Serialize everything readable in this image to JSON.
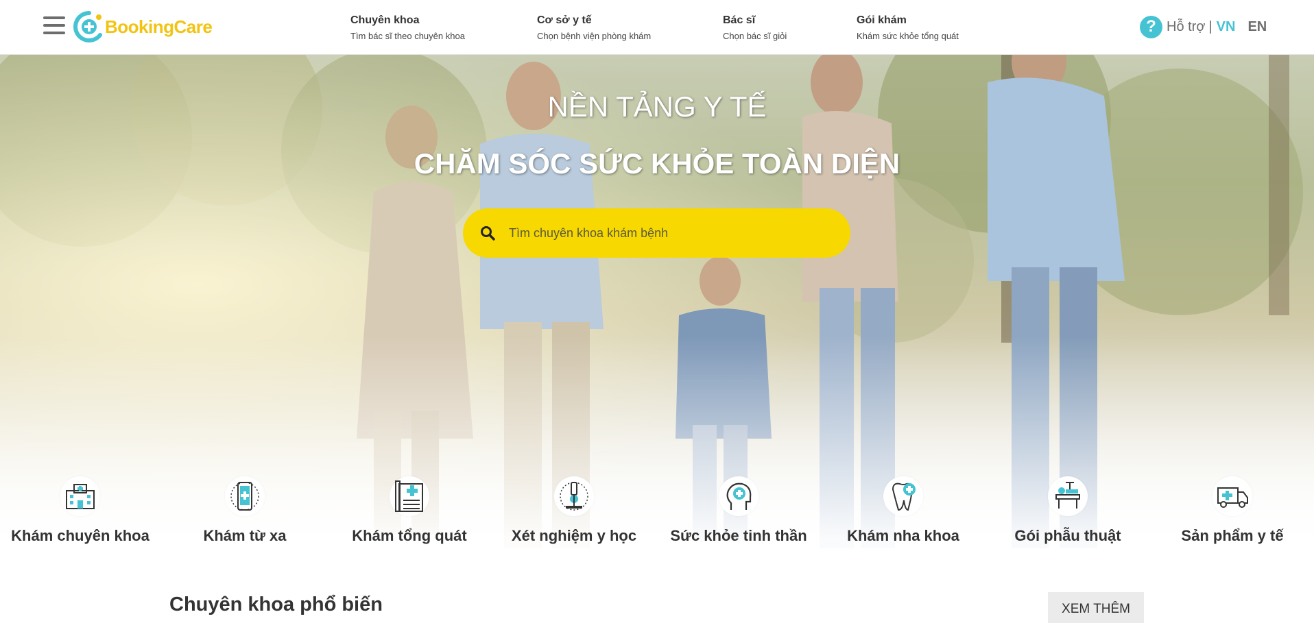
{
  "header": {
    "logo_text": "BookingCare",
    "nav": [
      {
        "title": "Chuyên khoa",
        "subtitle": "Tìm bác sĩ theo chuyên khoa"
      },
      {
        "title": "Cơ sở y tế",
        "subtitle": "Chọn bệnh viện phòng khám"
      },
      {
        "title": "Bác sĩ",
        "subtitle": "Chọn bác sĩ giỏi"
      },
      {
        "title": "Gói khám",
        "subtitle": "Khám sức khỏe tổng quát"
      }
    ],
    "support_label": "Hỗ trợ",
    "separator": "|",
    "lang_vn": "VN",
    "lang_en": "EN"
  },
  "hero": {
    "title_line1": "NỀN TẢNG Y TẾ",
    "title_line2": "CHĂM SÓC SỨC KHỎE TOÀN DIỆN",
    "search_placeholder": "Tìm chuyên khoa khám bệnh"
  },
  "options": [
    {
      "label": "Khám chuyên khoa",
      "icon": "hospital-icon"
    },
    {
      "label": "Khám từ xa",
      "icon": "phone-icon"
    },
    {
      "label": "Khám tổng quát",
      "icon": "clipboard-icon"
    },
    {
      "label": "Xét nghiệm y học",
      "icon": "microscope-icon"
    },
    {
      "label": "Sức khỏe tinh thần",
      "icon": "mental-health-icon"
    },
    {
      "label": "Khám nha khoa",
      "icon": "tooth-icon"
    },
    {
      "label": "Gói phẫu thuật",
      "icon": "surgery-icon"
    },
    {
      "label": "Sản phẩm y tế",
      "icon": "ambulance-icon"
    }
  ],
  "specialty": {
    "title": "Chuyên khoa phổ biến",
    "more_label": "XEM THÊM"
  },
  "colors": {
    "brand_yellow": "#f2c310",
    "accent_teal": "#45c3d2",
    "search_yellow": "#f7d800"
  }
}
